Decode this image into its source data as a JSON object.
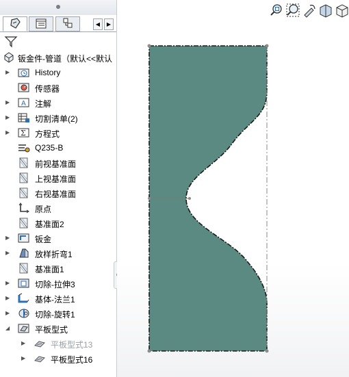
{
  "feature_tree": {
    "tabs": [
      "feature-manager",
      "property-manager",
      "configuration-manager"
    ],
    "filter_icon": "funnel-icon",
    "root_label": "钣金件-管道（默认<<默认",
    "items": [
      {
        "label": "History",
        "icon": "history-folder-icon",
        "expandable": true
      },
      {
        "label": "传感器",
        "icon": "sensor-icon",
        "expandable": false
      },
      {
        "label": "注解",
        "icon": "annotation-icon",
        "expandable": true
      },
      {
        "label": "切割清单(2)",
        "icon": "cut-list-icon",
        "expandable": true
      },
      {
        "label": "方程式",
        "icon": "equation-icon",
        "expandable": true
      },
      {
        "label": "Q235-B",
        "icon": "material-icon",
        "expandable": false
      },
      {
        "label": "前视基准面",
        "icon": "plane-icon",
        "expandable": false
      },
      {
        "label": "上视基准面",
        "icon": "plane-icon",
        "expandable": false
      },
      {
        "label": "右视基准面",
        "icon": "plane-icon",
        "expandable": false
      },
      {
        "label": "原点",
        "icon": "origin-icon",
        "expandable": false
      },
      {
        "label": "基准面2",
        "icon": "plane-icon",
        "expandable": false
      },
      {
        "label": "钣金",
        "icon": "sheet-metal-icon",
        "expandable": true
      },
      {
        "label": "放样折弯1",
        "icon": "lofted-bend-icon",
        "expandable": true
      },
      {
        "label": "基准面1",
        "icon": "plane-icon",
        "expandable": false
      },
      {
        "label": "切除-拉伸3",
        "icon": "extruded-cut-icon",
        "expandable": true
      },
      {
        "label": "基体-法兰1",
        "icon": "base-flange-icon",
        "expandable": true
      },
      {
        "label": "切除-旋转1",
        "icon": "revolved-cut-icon",
        "expandable": true
      },
      {
        "label": "平板型式",
        "icon": "flat-pattern-folder-icon",
        "expandable": true,
        "expanded": true
      },
      {
        "label": "平板型式13",
        "icon": "flat-pattern-icon",
        "expandable": true,
        "child": true,
        "suppressed": true
      },
      {
        "label": "平板型式16",
        "icon": "flat-pattern-icon",
        "expandable": true,
        "child": true
      }
    ]
  },
  "graphics": {
    "part_color": "#5b8a82",
    "edge_color": "#1a1a1a",
    "heads_up_toolbar": [
      "zoom-to-fit-icon",
      "zoom-to-area-icon",
      "previous-view-icon",
      "section-view-icon",
      "view-orientation-icon"
    ]
  },
  "colors": {
    "accent": "#2d6fb7",
    "panel_border": "#c8ccd2"
  }
}
